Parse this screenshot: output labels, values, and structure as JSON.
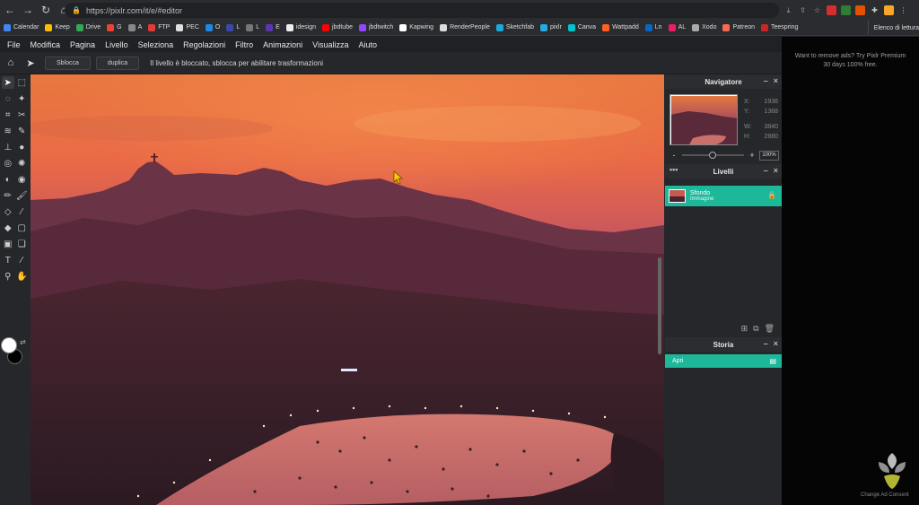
{
  "browser": {
    "url": "https://pixlr.com/it/e/#editor",
    "bookmarks": [
      {
        "label": "Calendar",
        "color": "#4285f4"
      },
      {
        "label": "Keep",
        "color": "#fbbc04"
      },
      {
        "label": "Drive",
        "color": "#34a853"
      },
      {
        "label": "G",
        "color": "#ea4335"
      },
      {
        "label": "A",
        "color": "#888888"
      },
      {
        "label": "FTP",
        "color": "#e53935"
      },
      {
        "label": "PEC",
        "color": "#e0e0e0"
      },
      {
        "label": "O",
        "color": "#1e88e5"
      },
      {
        "label": "L",
        "color": "#3949ab"
      },
      {
        "label": "L",
        "color": "#777777"
      },
      {
        "label": "E",
        "color": "#5e35b1"
      },
      {
        "label": "idesign",
        "color": "#eeeeee"
      },
      {
        "label": "jbdtube",
        "color": "#ff0000"
      },
      {
        "label": "jbdtwitch",
        "color": "#9146ff"
      },
      {
        "label": "Kapwing",
        "color": "#ffffff"
      },
      {
        "label": "RenderPeople",
        "color": "#dddddd"
      },
      {
        "label": "Sketchfab",
        "color": "#1caad9"
      },
      {
        "label": "pixlr",
        "color": "#27a9e1"
      },
      {
        "label": "Canva",
        "color": "#00c4cc"
      },
      {
        "label": "Wattpadd",
        "color": "#ff6122"
      },
      {
        "label": "Ln",
        "color": "#0a66c2"
      },
      {
        "label": "AL",
        "color": "#e91e63"
      },
      {
        "label": "Xodo",
        "color": "#aaaaaa"
      },
      {
        "label": "Patreon",
        "color": "#f96854"
      },
      {
        "label": "Teespring",
        "color": "#c62828"
      }
    ],
    "bookmarks_other": "Elenco di lettura"
  },
  "menu": [
    "File",
    "Modifica",
    "Pagina",
    "Livello",
    "Seleziona",
    "Regolazioni",
    "Filtro",
    "Animazioni",
    "Visualizza",
    "Aiuto"
  ],
  "options": {
    "unlock_label": "Sblocca",
    "duplicate_label": "duplica",
    "message": "Il livello è bloccato, sblocca per abilitare trasformazioni"
  },
  "navigator": {
    "title": "Navigatore",
    "x_label": "X:",
    "x_value": "1936",
    "y_label": "Y:",
    "y_value": "1368",
    "w_label": "W:",
    "w_value": "3840",
    "h_label": "H:",
    "h_value": "2880",
    "zoom_minus": "-",
    "zoom_plus": "+",
    "zoom_value": "100%",
    "zoom_fraction": 0.44
  },
  "layers": {
    "title": "Livelli",
    "items": [
      {
        "name": "Sfondo",
        "type": "Immagine",
        "locked": true
      }
    ]
  },
  "history": {
    "title": "Storia",
    "items": [
      {
        "label": "Apri"
      }
    ]
  },
  "ad": {
    "line1": "Want to remove ads? Try Pixlr Premium",
    "line2": "30 days 100% free.",
    "consent": "Change Ad Consent"
  },
  "colors": {
    "accent": "#1db89a",
    "foreground": "#ffffff",
    "background": "#000000"
  }
}
